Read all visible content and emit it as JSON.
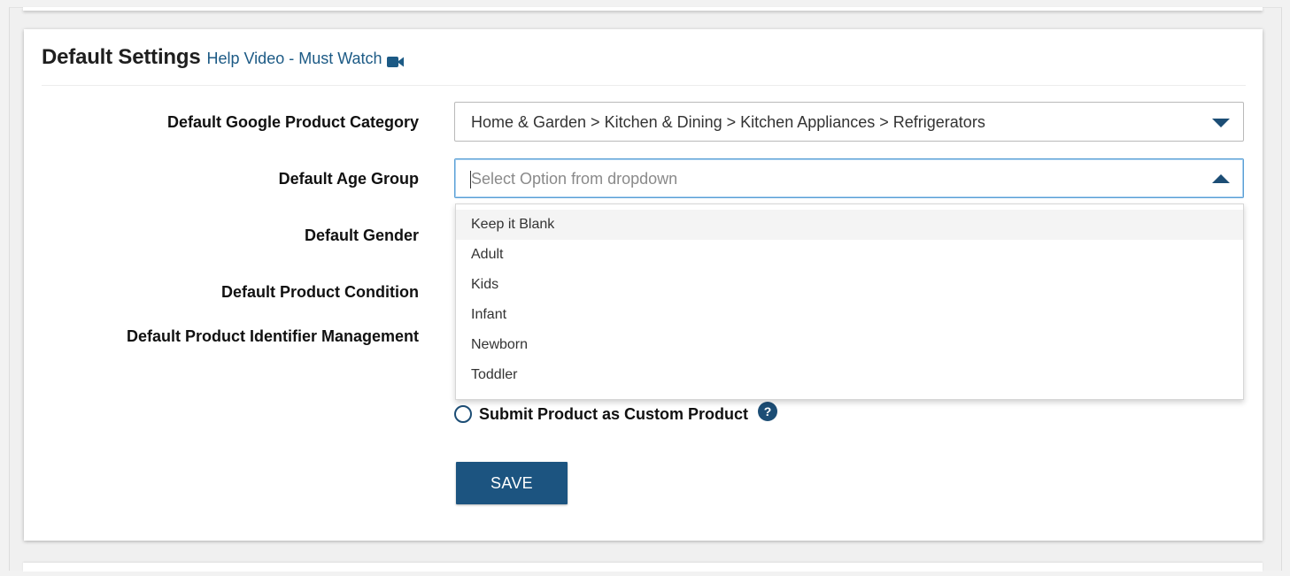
{
  "header": {
    "title": "Default Settings",
    "help_link": "Help Video - Must Watch",
    "help_icon": "video-camera-icon"
  },
  "form": {
    "google_category": {
      "label": "Default Google Product Category",
      "value": "Home & Garden > Kitchen & Dining > Kitchen Appliances > Refrigerators"
    },
    "age_group": {
      "label": "Default Age Group",
      "placeholder": "Select Option from dropdown",
      "expanded": true,
      "options": [
        "Keep it Blank",
        "Adult",
        "Kids",
        "Infant",
        "Newborn",
        "Toddler"
      ],
      "highlighted": "Keep it Blank"
    },
    "gender": {
      "label": "Default Gender"
    },
    "condition": {
      "label": "Default Product Condition"
    },
    "identifier": {
      "label": "Default Product Identifier Management"
    },
    "custom_product": {
      "label": "Submit Product as Custom Product",
      "checked": false,
      "help_glyph": "?"
    },
    "save_label": "SAVE"
  },
  "colors": {
    "accent": "#1c5480",
    "link": "#1c5a85",
    "focus_border": "#5a9fd4"
  }
}
